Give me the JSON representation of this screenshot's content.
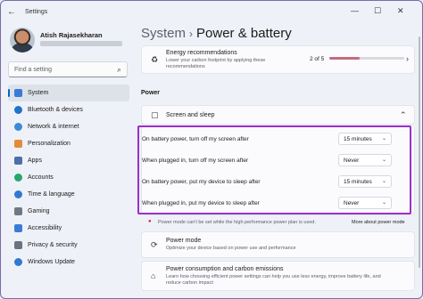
{
  "window": {
    "back_glyph": "←",
    "app_title": "Settings",
    "minimize_glyph": "—",
    "maximize_glyph": "☐",
    "close_glyph": "✕"
  },
  "profile": {
    "name": "Atish Rajasekharan"
  },
  "search": {
    "placeholder": "Find a setting",
    "icon_glyph": "⌕"
  },
  "sidebar": {
    "items": [
      {
        "label": "System",
        "icon": "monitor-icon",
        "color": "#3b7bd8",
        "active": true
      },
      {
        "label": "Bluetooth & devices",
        "icon": "bluetooth-icon",
        "color": "#1f73c8"
      },
      {
        "label": "Network & internet",
        "icon": "wifi-icon",
        "color": "#3d8ad8"
      },
      {
        "label": "Personalization",
        "icon": "brush-icon",
        "color": "#e58a3a"
      },
      {
        "label": "Apps",
        "icon": "apps-icon",
        "color": "#4d6fa8"
      },
      {
        "label": "Accounts",
        "icon": "person-icon",
        "color": "#2aa56b"
      },
      {
        "label": "Time & language",
        "icon": "globe-icon",
        "color": "#2f7ad1"
      },
      {
        "label": "Gaming",
        "icon": "controller-icon",
        "color": "#707884"
      },
      {
        "label": "Accessibility",
        "icon": "accessibility-icon",
        "color": "#3b7bd8"
      },
      {
        "label": "Privacy & security",
        "icon": "shield-icon",
        "color": "#6b7280"
      },
      {
        "label": "Windows Update",
        "icon": "update-icon",
        "color": "#2f7ad1"
      }
    ]
  },
  "breadcrumb": {
    "parent": "System",
    "separator": "›",
    "current": "Power & battery"
  },
  "energy": {
    "title": "Energy recommendations",
    "subtitle_line1": "Lower your carbon footprint by applying these",
    "subtitle_line2": "recommendations",
    "count": "2 of 5",
    "progress_fraction": 0.4,
    "chevron_glyph": "›",
    "icon_glyph": "♻"
  },
  "power_section": {
    "title": "Power"
  },
  "screen_sleep": {
    "title": "Screen and sleep",
    "chevron_glyph": "⌃",
    "icon_glyph": "▢",
    "rows": [
      {
        "label": "On battery power, turn off my screen after",
        "value": "15 minutes"
      },
      {
        "label": "When plugged in, turn off my screen after",
        "value": "Never"
      },
      {
        "label": "On battery power, put my device to sleep after",
        "value": "15 minutes"
      },
      {
        "label": "When plugged in, put my device to sleep after",
        "value": "Never"
      }
    ],
    "dropdown_glyph": "⌄"
  },
  "notice": {
    "text": "Power mode can't be set while the high performance power plan is used.",
    "link": "More about power mode",
    "icon_glyph": "●"
  },
  "power_mode": {
    "title": "Power mode",
    "subtitle": "Optimize your device based on power use and performance",
    "icon_glyph": "⟳"
  },
  "carbon": {
    "title": "Power consumption and carbon emissions",
    "subtitle_line1": "Learn how choosing efficient power settings can help you use less energy, improve battery life, and",
    "subtitle_line2": "reduce carbon impact",
    "icon_glyph": "⌂"
  }
}
